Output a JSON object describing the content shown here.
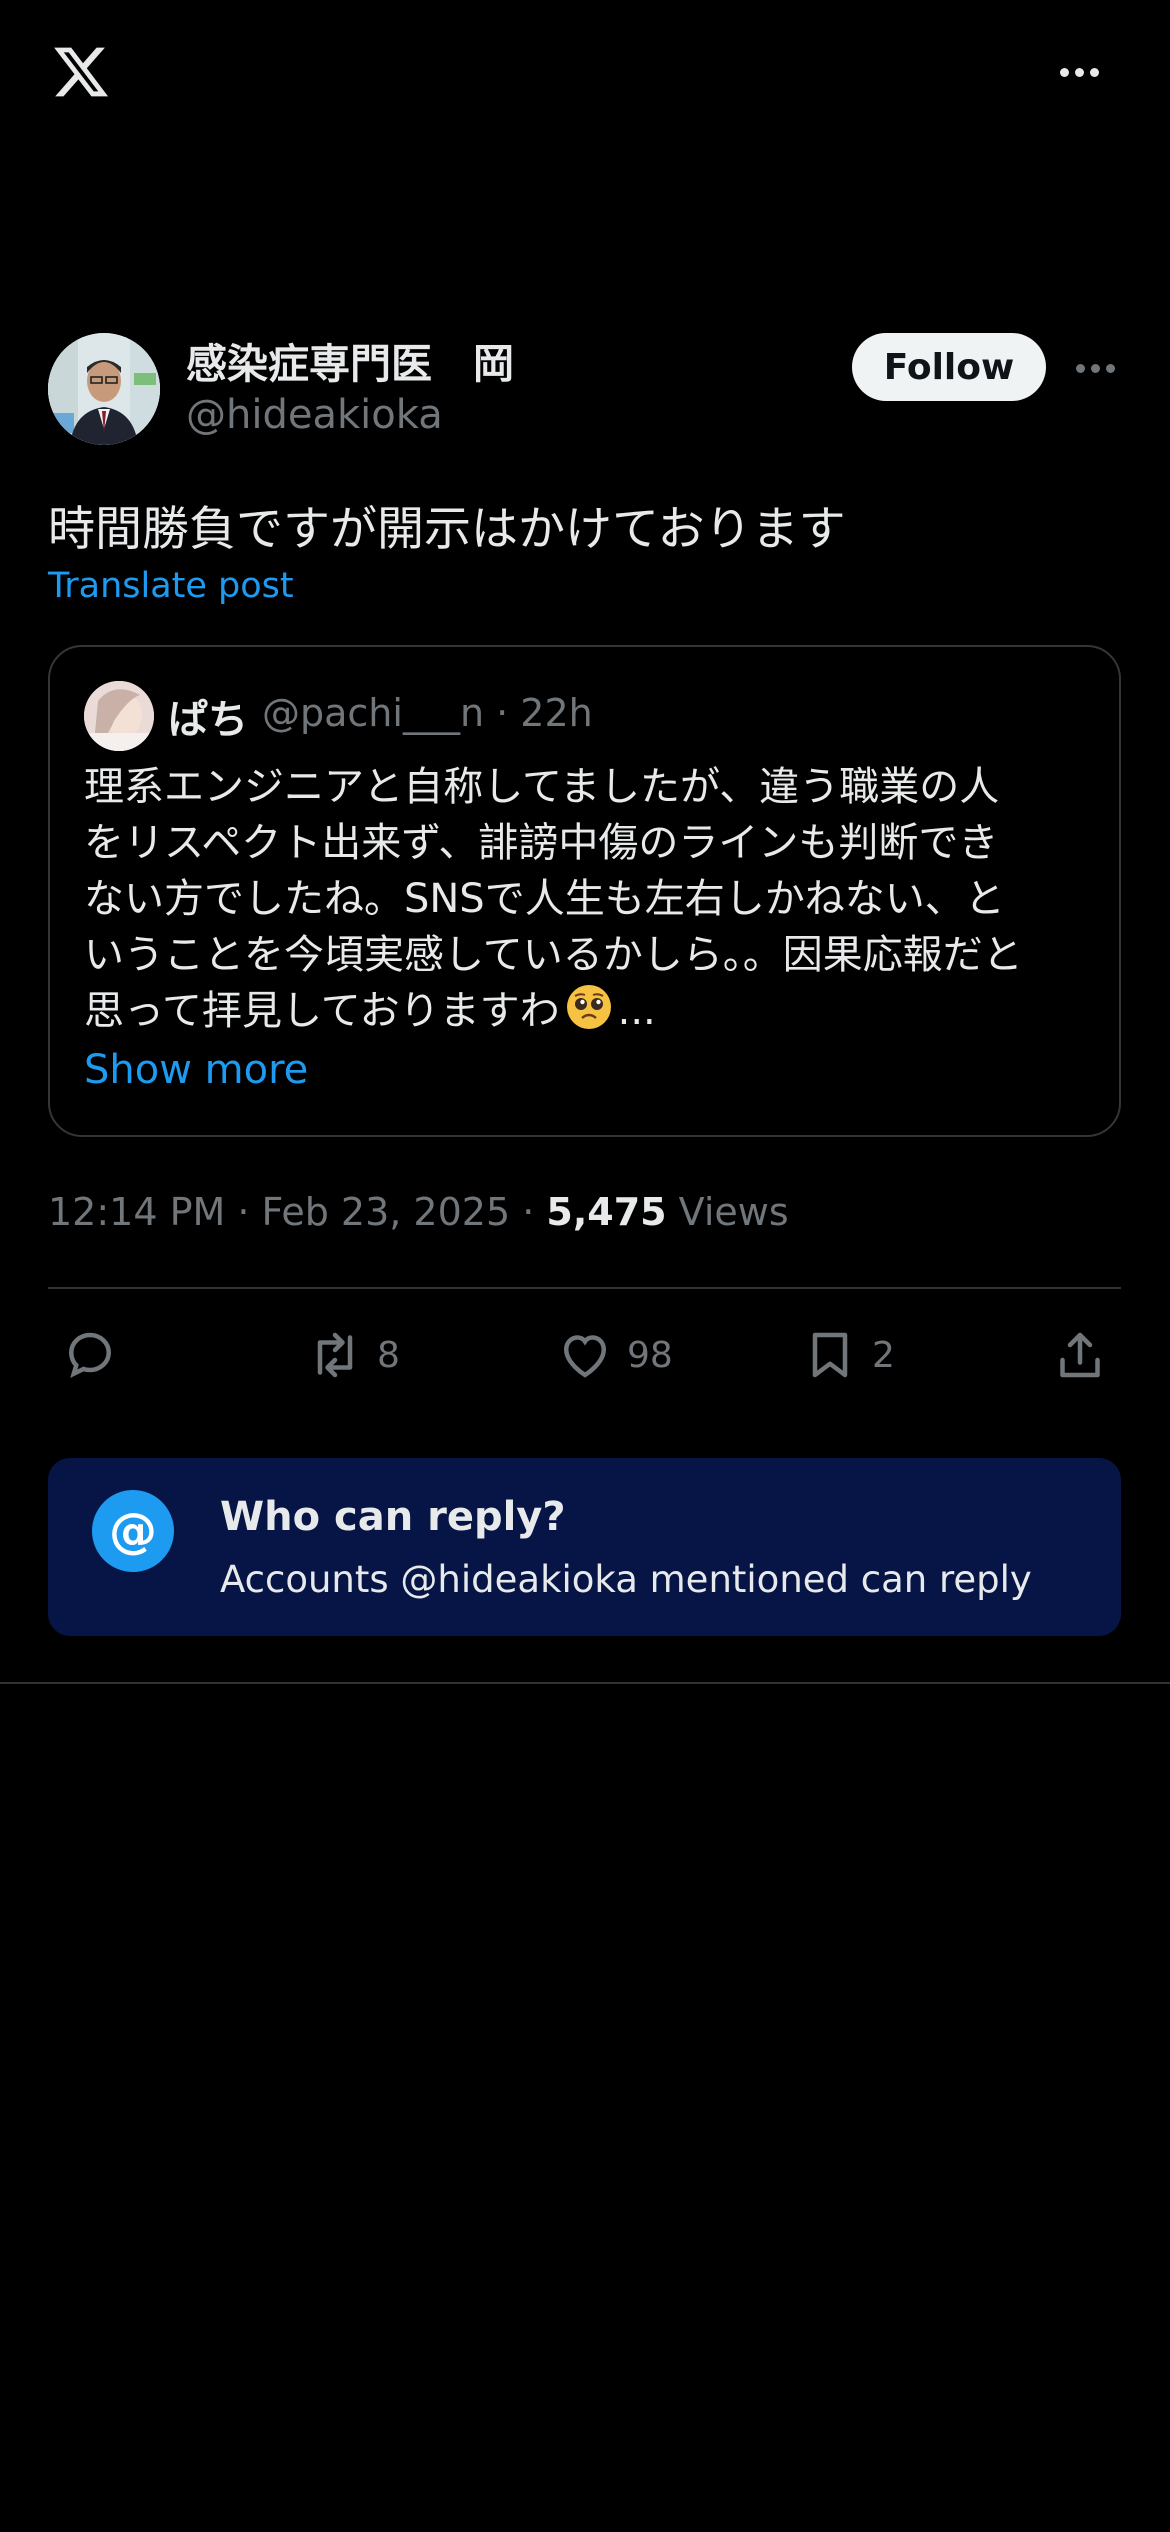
{
  "author": {
    "name": "感染症専門医　岡",
    "handle": "@hideakioka",
    "follow_label": "Follow"
  },
  "post": {
    "text": "時間勝負ですが開示はかけております",
    "translate_label": "Translate post",
    "time": "12:14 PM",
    "date": "Feb 23, 2025",
    "views_count": "5,475",
    "views_label": "Views"
  },
  "quote": {
    "name": "ぱち",
    "handle": "@pachi___n",
    "time": "22h",
    "lines": [
      "理系エンジニアと自称してましたが、違う職業の人",
      "をリスペクト出来ず、誹謗中傷のラインも判断でき",
      "ない方でしたね。SNSで人生も左右しかねない、と",
      "いうことを今頃実感しているかしら。。因果応報だと",
      "思って拝見しておりますわ"
    ],
    "ellipsis": "...",
    "show_more": "Show more"
  },
  "actions": {
    "replies": "",
    "reposts": "8",
    "likes": "98",
    "bookmarks": "2"
  },
  "who_can_reply": {
    "icon": "@",
    "title": "Who can reply?",
    "subtitle": "Accounts @hideakioka mentioned can reply"
  },
  "colors": {
    "background": "#000000",
    "accent": "#1d9bf0",
    "muted": "#71767b",
    "banner": "#061546"
  }
}
